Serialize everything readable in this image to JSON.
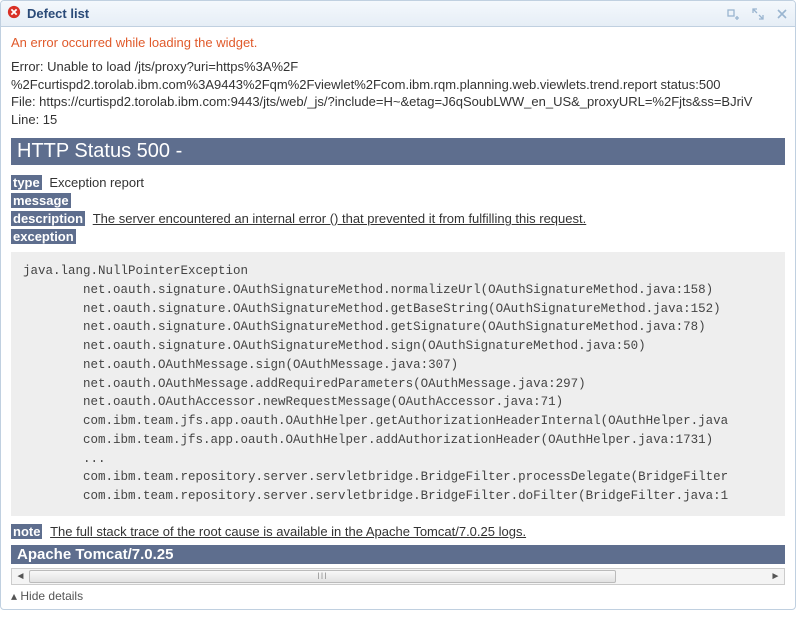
{
  "titlebar": {
    "title": "Defect list",
    "error_icon": "error-icon",
    "minimize_icon": "minimize-icon",
    "expand_icon": "expand-icon",
    "close_icon": "close-icon"
  },
  "load_error": "An error occurred while loading the widget.",
  "error_block": {
    "line1": "Error: Unable to load /jts/proxy?uri=https%3A%2F",
    "line2": "%2Fcurtispd2.torolab.ibm.com%3A9443%2Fqm%2Fviewlet%2Fcom.ibm.rqm.planning.web.viewlets.trend.report status:500",
    "line3": "File: https://curtispd2.torolab.ibm.com:9443/jts/web/_js/?include=H~&etag=J6qSoubLWW_en_US&_proxyURL=%2Fjts&ss=BJriV",
    "line4": "Line: 15"
  },
  "status_heading": "HTTP Status 500 -",
  "labels": {
    "type": "type",
    "message": "message",
    "description": "description",
    "exception": "exception",
    "note": "note"
  },
  "values": {
    "type": "Exception report",
    "description": "The server encountered an internal error () that prevented it from fulfilling this request.",
    "note": "The full stack trace of the root cause is available in the Apache Tomcat/7.0.25 logs."
  },
  "stack": "java.lang.NullPointerException\n\tnet.oauth.signature.OAuthSignatureMethod.normalizeUrl(OAuthSignatureMethod.java:158)\n\tnet.oauth.signature.OAuthSignatureMethod.getBaseString(OAuthSignatureMethod.java:152)\n\tnet.oauth.signature.OAuthSignatureMethod.getSignature(OAuthSignatureMethod.java:78)\n\tnet.oauth.signature.OAuthSignatureMethod.sign(OAuthSignatureMethod.java:50)\n\tnet.oauth.OAuthMessage.sign(OAuthMessage.java:307)\n\tnet.oauth.OAuthMessage.addRequiredParameters(OAuthMessage.java:297)\n\tnet.oauth.OAuthAccessor.newRequestMessage(OAuthAccessor.java:71)\n\tcom.ibm.team.jfs.app.oauth.OAuthHelper.getAuthorizationHeaderInternal(OAuthHelper.java\n\tcom.ibm.team.jfs.app.oauth.OAuthHelper.addAuthorizationHeader(OAuthHelper.java:1731)\n\t...\n\tcom.ibm.team.repository.server.servletbridge.BridgeFilter.processDelegate(BridgeFilter\n\tcom.ibm.team.repository.server.servletbridge.BridgeFilter.doFilter(BridgeFilter.java:1",
  "tomcat": "Apache Tomcat/7.0.25",
  "hide_details": "Hide details",
  "hide_details_caret": "▴"
}
